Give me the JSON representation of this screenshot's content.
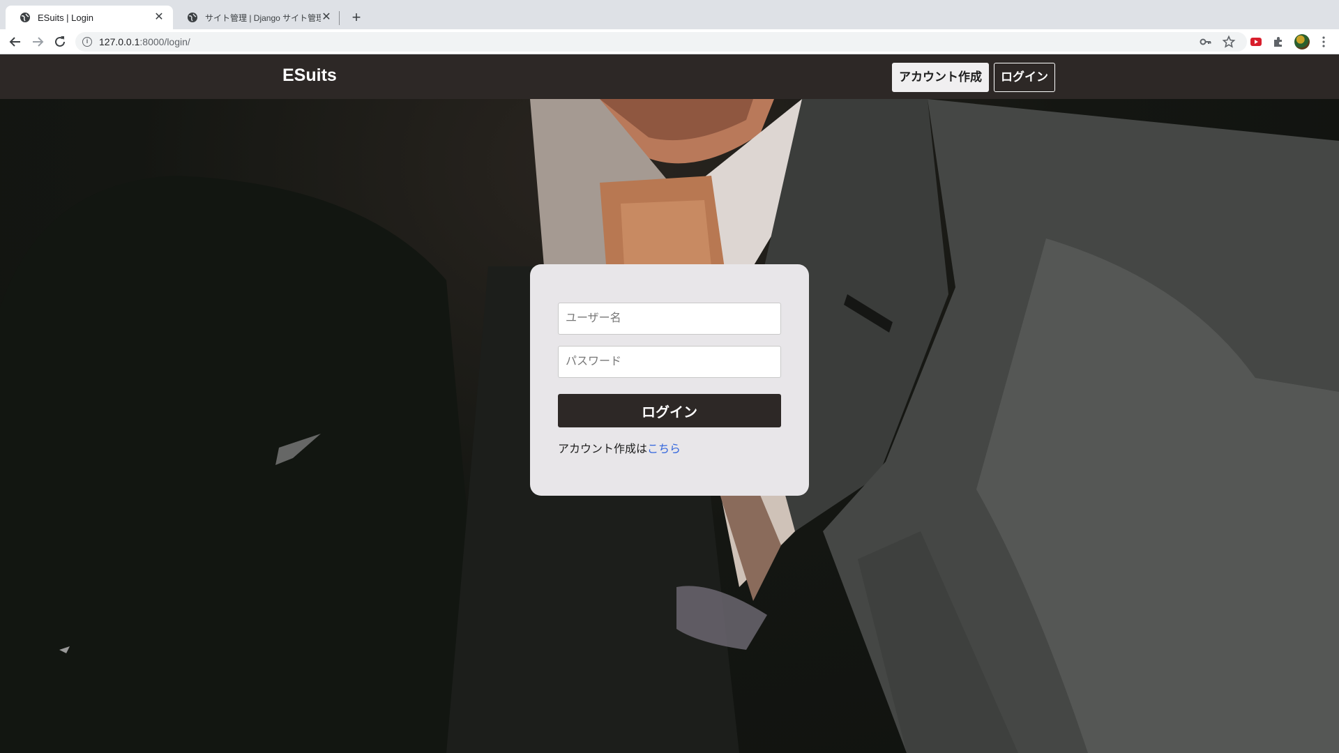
{
  "browser": {
    "tabs": [
      {
        "title": "ESuits | Login",
        "active": true
      },
      {
        "title": "サイト管理 | Django サイト管理",
        "active": false
      }
    ],
    "close_glyph": "✕",
    "newtab_glyph": "+",
    "url_host": "127.0.0.1",
    "url_path": ":8000/login/",
    "info_glyph": "i"
  },
  "site": {
    "brand": "ESuits",
    "nav": {
      "signup": "アカウント作成",
      "login": "ログイン"
    }
  },
  "login_form": {
    "username_placeholder": "ユーザー名",
    "password_placeholder": "パスワード",
    "submit": "ログイン",
    "signup_prompt": "アカウント作成は",
    "signup_link": "こちら"
  },
  "colors": {
    "header_bg": "#2d2826",
    "card_bg": "#e8e6e9",
    "link": "#3366dd"
  }
}
